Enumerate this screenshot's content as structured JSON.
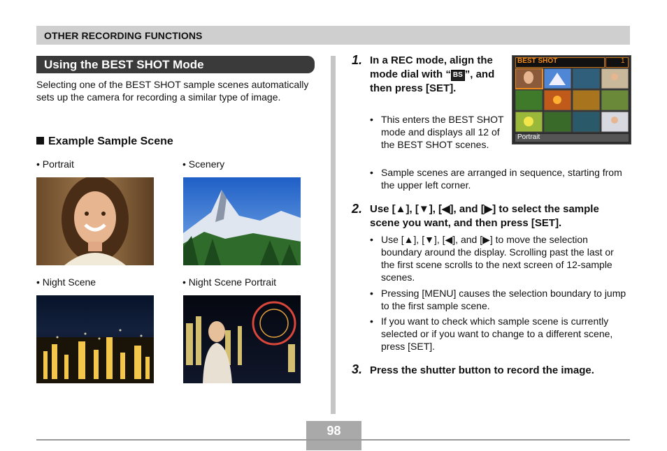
{
  "header": {
    "section": "OTHER RECORDING FUNCTIONS"
  },
  "left": {
    "section_title": "Using the BEST SHOT Mode",
    "intro": "Selecting one of the BEST SHOT sample scenes automatically sets up the camera for recording a similar type of image.",
    "example_heading": "Example Sample Scene",
    "scenes": [
      {
        "label": "• Portrait"
      },
      {
        "label": "• Scenery"
      },
      {
        "label": "• Night Scene"
      },
      {
        "label": "• Night Scene Portrait"
      }
    ]
  },
  "steps": [
    {
      "num": "1.",
      "head_a": "In a REC mode, align the mode dial with “",
      "head_icon": "BS",
      "head_b": "”, and then press [SET].",
      "bullets": [
        "This enters the BEST SHOT mode and displays all 12 of the BEST SHOT scenes.",
        "Sample scenes are arranged in sequence, starting from the upper left corner."
      ]
    },
    {
      "num": "2.",
      "head": "Use [▲], [▼], [◀], and [▶] to select the sample scene you want, and then press [SET].",
      "bullets": [
        "Use [▲], [▼], [◀], and [▶] to move the selection boundary around the display. Scrolling past the last or the first scene scrolls to the next screen of 12-sample scenes.",
        "Pressing [MENU] causes the selection boundary to jump to the first sample scene.",
        "If you want to check which sample scene is currently selected or if you want to change to a different scene, press [SET]."
      ]
    },
    {
      "num": "3.",
      "head": "Press the shutter button to record the image."
    }
  ],
  "lcd": {
    "title": "BEST SHOT",
    "page": "1",
    "caption": "Portrait"
  },
  "footer": {
    "page": "98"
  }
}
